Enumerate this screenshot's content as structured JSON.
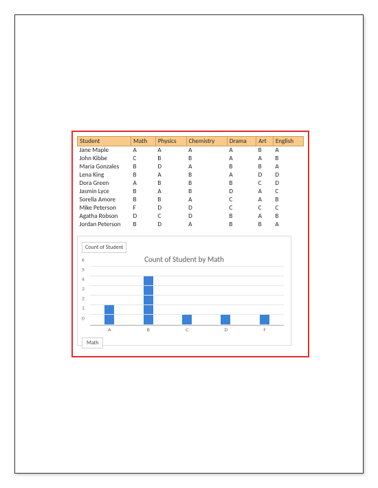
{
  "table": {
    "headers": [
      "Student",
      "Math",
      "Physics",
      "Chemistry",
      "Drama",
      "Art",
      "English"
    ],
    "rows": [
      [
        "Jane Maple",
        "A",
        "A",
        "A",
        "A",
        "B",
        "A"
      ],
      [
        "John Kibbe",
        "C",
        "B",
        "B",
        "A",
        "A",
        "B"
      ],
      [
        "Maria Gonzales",
        "B",
        "D",
        "A",
        "B",
        "B",
        "A"
      ],
      [
        "Lena King",
        "B",
        "A",
        "B",
        "A",
        "D",
        "D"
      ],
      [
        "Dora Green",
        "A",
        "B",
        "B",
        "B",
        "C",
        "D"
      ],
      [
        "Jasmin Lyce",
        "B",
        "A",
        "B",
        "D",
        "A",
        "C"
      ],
      [
        "Sorella Amore",
        "B",
        "B",
        "A",
        "C",
        "A",
        "B"
      ],
      [
        "Mike Peterson",
        "F",
        "D",
        "D",
        "C",
        "C",
        "C"
      ],
      [
        "Agatha Robson",
        "D",
        "C",
        "D",
        "B",
        "A",
        "B"
      ],
      [
        "Jordan Peterson",
        "B",
        "D",
        "A",
        "B",
        "B",
        "A"
      ]
    ]
  },
  "chart": {
    "field_label": "Count of Student",
    "axis_label": "Math",
    "title": "Count of Student by Math"
  },
  "chart_data": {
    "type": "bar",
    "title": "Count of Student by Math",
    "xlabel": "Math",
    "ylabel": "Count of Student",
    "categories": [
      "A",
      "B",
      "C",
      "D",
      "F"
    ],
    "values": [
      2,
      5,
      1,
      1,
      1
    ],
    "ylim": [
      0,
      6
    ],
    "yticks": [
      0,
      1,
      2,
      3,
      4,
      5,
      6
    ],
    "grid": true
  }
}
